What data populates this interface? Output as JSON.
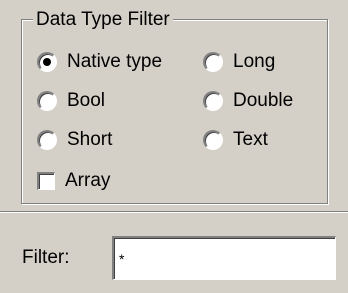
{
  "group": {
    "title": "Data Type Filter"
  },
  "options": {
    "native_type": "Native type",
    "long": "Long",
    "bool": "Bool",
    "double": "Double",
    "short": "Short",
    "text": "Text"
  },
  "selected_option": "Native type",
  "array": {
    "label": "Array",
    "checked": false
  },
  "filter": {
    "label": "Filter:",
    "value": "*"
  }
}
